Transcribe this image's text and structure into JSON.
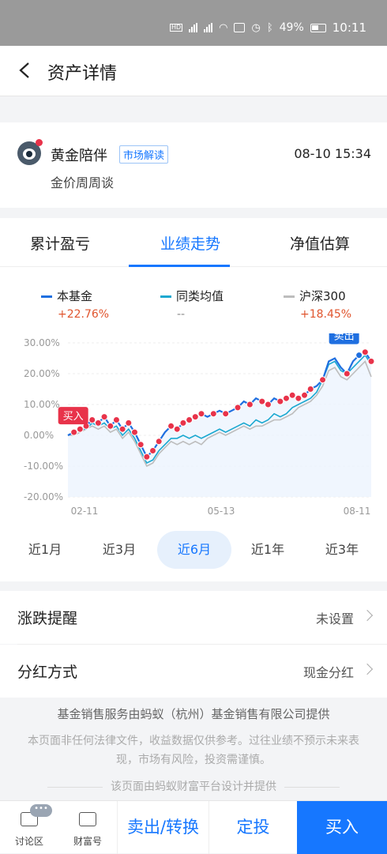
{
  "status_bar": {
    "battery": "49%",
    "time": "10:11"
  },
  "header": {
    "title": "资产详情"
  },
  "news": {
    "name": "黄金陪伴",
    "tag": "市场解读",
    "time": "08-10 15:34",
    "subtitle": "金价周周谈"
  },
  "tabs": [
    {
      "label": "累计盈亏"
    },
    {
      "label": "业绩走势"
    },
    {
      "label": "净值估算"
    }
  ],
  "legend": [
    {
      "name": "本基金",
      "value": "+22.76%",
      "color": "#1f6fe0"
    },
    {
      "name": "同类均值",
      "value": "--",
      "color": "#1aa8d0"
    },
    {
      "name": "沪深300",
      "value": "+18.45%",
      "color": "#bdbdbd"
    }
  ],
  "chart_data": {
    "type": "line",
    "yticks": [
      "30.00%",
      "20.00%",
      "10.00%",
      "0.00%",
      "-10.00%",
      "-20.00%"
    ],
    "ylim": [
      -20,
      30
    ],
    "xticks": [
      "02-11",
      "05-13",
      "08-11"
    ],
    "marker_buy": "买入",
    "marker_sell": "卖出",
    "series": [
      {
        "name": "本基金",
        "color": "#1f6fe0",
        "values": [
          0,
          1,
          2,
          3,
          5,
          4,
          6,
          3,
          5,
          2,
          4,
          1,
          -3,
          -7,
          -5,
          -2,
          1,
          3,
          2,
          4,
          5,
          6,
          7,
          6,
          7,
          8,
          7,
          8,
          9,
          11,
          10,
          12,
          11,
          10,
          12,
          11,
          12,
          13,
          12,
          13,
          15,
          16,
          18,
          24,
          25,
          22,
          20,
          24,
          26,
          27,
          24
        ]
      },
      {
        "name": "同类均值",
        "color": "#1aa8d0",
        "values": [
          0,
          1,
          2,
          2,
          4,
          3,
          4,
          2,
          3,
          0,
          2,
          -1,
          -5,
          -9,
          -8,
          -5,
          -3,
          -1,
          -1,
          0,
          -1,
          0,
          -1,
          0,
          1,
          2,
          1,
          2,
          3,
          4,
          3,
          5,
          4,
          5,
          7,
          6,
          7,
          9,
          10,
          11,
          12,
          14,
          18,
          23,
          24,
          21,
          20,
          22,
          24,
          26,
          23
        ]
      },
      {
        "name": "沪深300",
        "color": "#bdbdbd",
        "values": [
          0,
          0,
          1,
          2,
          3,
          2,
          3,
          1,
          2,
          -1,
          1,
          -2,
          -6,
          -10,
          -9,
          -6,
          -4,
          -2,
          -3,
          -2,
          -3,
          -2,
          -3,
          -1,
          0,
          1,
          0,
          1,
          2,
          3,
          2,
          3,
          3,
          4,
          5,
          5,
          6,
          7,
          9,
          10,
          11,
          13,
          16,
          21,
          22,
          19,
          18,
          20,
          22,
          24,
          19
        ]
      }
    ],
    "buy_points": [
      1,
      2,
      3,
      4,
      5,
      6,
      7,
      8,
      9,
      10,
      11,
      12,
      13,
      14,
      15,
      17,
      18,
      19,
      20,
      21,
      22,
      24,
      26,
      28,
      30,
      32,
      33,
      35,
      36,
      37,
      38,
      39,
      40,
      42,
      46,
      48,
      49,
      50
    ]
  },
  "periods": [
    {
      "label": "近1月"
    },
    {
      "label": "近3月"
    },
    {
      "label": "近6月"
    },
    {
      "label": "近1年"
    },
    {
      "label": "近3年"
    }
  ],
  "settings": [
    {
      "label": "涨跌提醒",
      "value": "未设置"
    },
    {
      "label": "分红方式",
      "value": "现金分红"
    }
  ],
  "footer": {
    "provider": "基金销售服务由蚂蚁（杭州）基金销售有限公司提供",
    "disclaimer": "本页面非任何法律文件，收益数据仅供参考。过往业绩不预示未来表现，市场有风险，投资需谨慎。",
    "design_note": "该页面由蚂蚁财富平台设计并提供"
  },
  "bottom_bar": {
    "discuss": "讨论区",
    "discuss_badge": "•••",
    "wealth": "财富号",
    "sell": "卖出/转换",
    "fixed": "定投",
    "buy": "买入"
  }
}
